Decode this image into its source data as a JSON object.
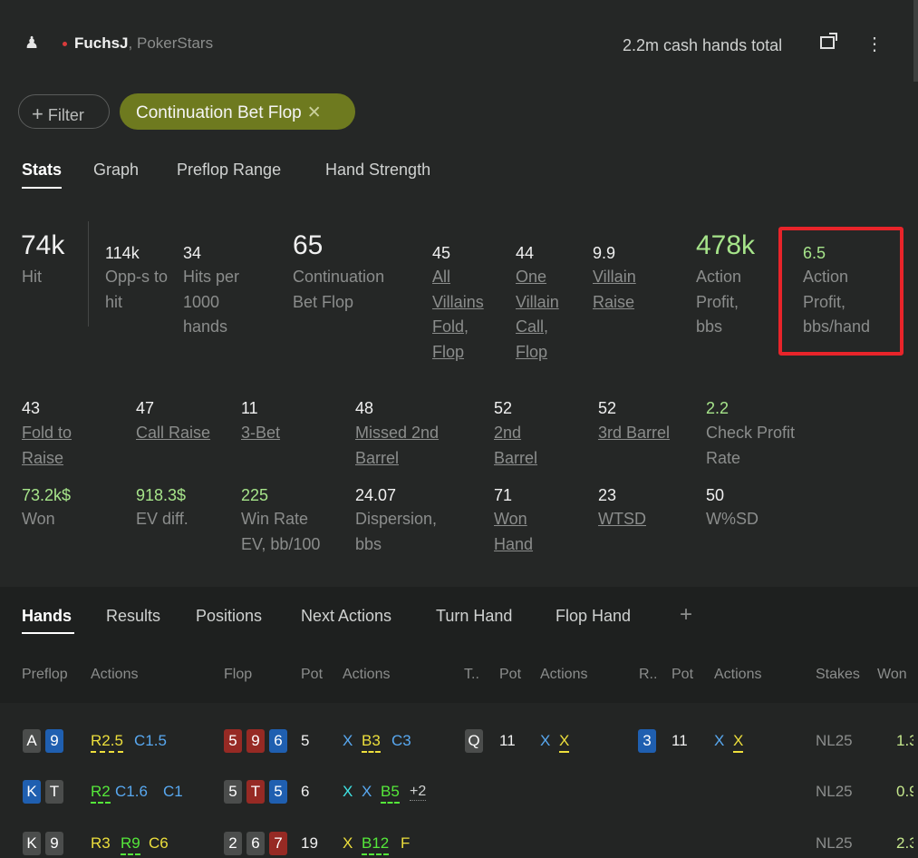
{
  "header": {
    "player": "FuchsJ",
    "site": ", PokerStars",
    "hands_total": "2.2m cash hands total"
  },
  "filter": {
    "label": "Filter",
    "chip": "Continuation Bet Flop"
  },
  "tabs": [
    "Stats",
    "Graph",
    "Preflop Range",
    "Hand Strength"
  ],
  "stats_top": [
    {
      "value": "74k",
      "label": "Hit"
    },
    {
      "value": "114k",
      "label": "Opp-s to hit"
    },
    {
      "value": "34",
      "label": "Hits per 1000 hands"
    },
    {
      "value": "65",
      "label": "Continuation Bet Flop"
    },
    {
      "value": "45",
      "label": "All Villains Fold, Flop"
    },
    {
      "value": "44",
      "label": "One Villain Call, Flop"
    },
    {
      "value": "9.9",
      "label": "Villain Raise"
    },
    {
      "value": "478k",
      "label": "Action Profit, bbs"
    },
    {
      "value": "6.5",
      "label": "Action Profit, bbs/hand"
    }
  ],
  "stats_row2": [
    {
      "value": "43",
      "label": "Fold to Raise"
    },
    {
      "value": "47",
      "label": "Call Raise"
    },
    {
      "value": "11",
      "label": "3-Bet"
    },
    {
      "value": "48",
      "label": "Missed 2nd Barrel"
    },
    {
      "value": "52",
      "label": "2nd Barrel"
    },
    {
      "value": "52",
      "label": "3rd Barrel"
    },
    {
      "value": "2.2",
      "label": "Check Profit Rate"
    }
  ],
  "stats_row3": [
    {
      "value": "73.2k$",
      "label": "Won"
    },
    {
      "value": "918.3$",
      "label": "EV diff."
    },
    {
      "value": "225",
      "label": "Win Rate EV, bb/100"
    },
    {
      "value": "24.07",
      "label": "Dispersion, bbs"
    },
    {
      "value": "71",
      "label": "Won Hand"
    },
    {
      "value": "23",
      "label": "WTSD"
    },
    {
      "value": "50",
      "label": "W%SD"
    }
  ],
  "hand_tabs": [
    "Hands",
    "Results",
    "Positions",
    "Next Actions",
    "Turn Hand",
    "Flop Hand"
  ],
  "columns": [
    "Preflop",
    "Actions",
    "Flop",
    "Pot",
    "Actions",
    "T..",
    "Pot",
    "Actions",
    "R..",
    "Pot",
    "Actions",
    "Stakes",
    "Won"
  ],
  "rows": [
    {
      "hole": [
        "A",
        "9"
      ],
      "pre": [
        "R2.5",
        "C1.5"
      ],
      "flop": [
        "5",
        "9",
        "6"
      ],
      "flop_pot": "5",
      "flop_act": [
        "X",
        "B3",
        "C3"
      ],
      "turn": "Q",
      "turn_pot": "11",
      "turn_act": [
        "X",
        "X"
      ],
      "river": "3",
      "river_pot": "11",
      "river_act": [
        "X",
        "X"
      ],
      "stakes": "NL25",
      "won": "1.3"
    },
    {
      "hole": [
        "K",
        "T"
      ],
      "pre": [
        "R2",
        "C1.6",
        "C1"
      ],
      "flop": [
        "5",
        "T",
        "5"
      ],
      "flop_pot": "6",
      "flop_act": [
        "X",
        "X",
        "B5",
        "+2"
      ],
      "stakes": "NL25",
      "won": "0.9"
    },
    {
      "hole": [
        "K",
        "9"
      ],
      "pre": [
        "R3",
        "R9",
        "C6"
      ],
      "flop": [
        "2",
        "6",
        "7"
      ],
      "flop_pot": "19",
      "flop_act": [
        "X",
        "B12",
        "F"
      ],
      "stakes": "NL25",
      "won": "2.3"
    }
  ]
}
